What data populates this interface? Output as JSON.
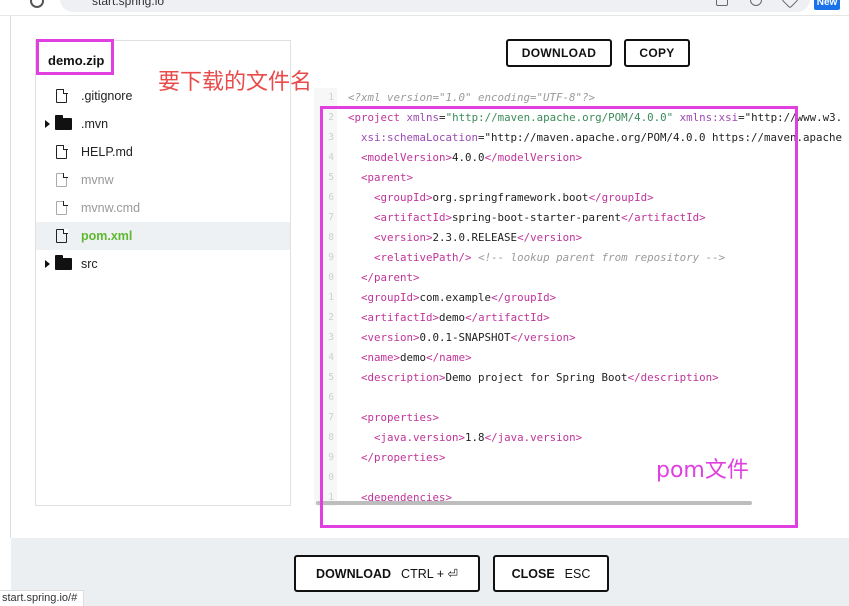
{
  "browser": {
    "url": "start.spring.io",
    "new_badge": "New"
  },
  "tree": {
    "title": "demo.zip",
    "items": [
      {
        "label": ".gitignore",
        "kind": "file",
        "state": "normal"
      },
      {
        "label": ".mvn",
        "kind": "folder",
        "state": "normal"
      },
      {
        "label": "HELP.md",
        "kind": "file",
        "state": "normal"
      },
      {
        "label": "mvnw",
        "kind": "file",
        "state": "dim"
      },
      {
        "label": "mvnw.cmd",
        "kind": "file",
        "state": "dim"
      },
      {
        "label": "pom.xml",
        "kind": "file",
        "state": "selected"
      },
      {
        "label": "src",
        "kind": "folder",
        "state": "normal"
      }
    ]
  },
  "toolbar": {
    "download_label": "DOWNLOAD",
    "copy_label": "COPY"
  },
  "annotations": {
    "zip_note": "要下载的文件名",
    "pom_note": "pom文件"
  },
  "code": {
    "lines": [
      {
        "n": "1",
        "text": "<?xml version=\"1.0\" encoding=\"UTF-8\"?>"
      },
      {
        "n": "2",
        "text": "<project xmlns=\"http://maven.apache.org/POM/4.0.0\" xmlns:xsi=\"http://www.w3."
      },
      {
        "n": "3",
        "text": "  xsi:schemaLocation=\"http://maven.apache.org/POM/4.0.0 https://maven.apache"
      },
      {
        "n": "4",
        "text": "  <modelVersion>4.0.0</modelVersion>"
      },
      {
        "n": "5",
        "text": "  <parent>"
      },
      {
        "n": "6",
        "text": "    <groupId>org.springframework.boot</groupId>"
      },
      {
        "n": "7",
        "text": "    <artifactId>spring-boot-starter-parent</artifactId>"
      },
      {
        "n": "8",
        "text": "    <version>2.3.0.RELEASE</version>"
      },
      {
        "n": "9",
        "text": "    <relativePath/> <!-- lookup parent from repository -->"
      },
      {
        "n": "0",
        "text": "  </parent>"
      },
      {
        "n": "1",
        "text": "  <groupId>com.example</groupId>"
      },
      {
        "n": "2",
        "text": "  <artifactId>demo</artifactId>"
      },
      {
        "n": "3",
        "text": "  <version>0.0.1-SNAPSHOT</version>"
      },
      {
        "n": "4",
        "text": "  <name>demo</name>"
      },
      {
        "n": "5",
        "text": "  <description>Demo project for Spring Boot</description>"
      },
      {
        "n": "6",
        "text": ""
      },
      {
        "n": "7",
        "text": "  <properties>"
      },
      {
        "n": "8",
        "text": "    <java.version>1.8</java.version>"
      },
      {
        "n": "9",
        "text": "  </properties>"
      },
      {
        "n": "0",
        "text": ""
      },
      {
        "n": "1",
        "text": "  <dependencies>"
      }
    ]
  },
  "footer": {
    "download_label": "DOWNLOAD",
    "download_shortcut": "CTRL + ⏎",
    "close_label": "CLOSE",
    "close_shortcut": "ESC"
  },
  "status_bar": {
    "text": "start.spring.io/#"
  },
  "colors": {
    "annotation_box": "#e040e0",
    "annotation_zip_text": "#e94b4b",
    "selected_file": "#5fb832",
    "xml_tag": "#c0349a",
    "xml_string": "#3a8b5a"
  }
}
